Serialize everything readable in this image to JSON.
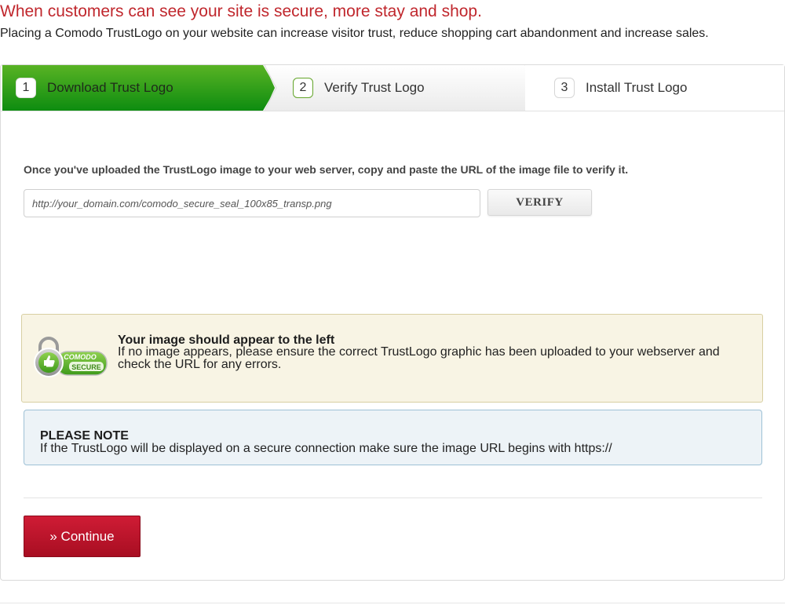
{
  "header": {
    "headline": "When customers can see your site is secure, more stay and shop.",
    "subline": "Placing a Comodo TrustLogo on your website can increase visitor trust, reduce shopping cart abandonment and increase sales."
  },
  "steps": [
    {
      "number": "1",
      "label": "Download Trust Logo",
      "state": "complete"
    },
    {
      "number": "2",
      "label": "Verify Trust Logo",
      "state": "current"
    },
    {
      "number": "3",
      "label": "Install Trust Logo",
      "state": "upcoming"
    }
  ],
  "verify": {
    "instruction": "Once you've uploaded the TrustLogo image to your web server, copy and paste the URL of the image file to verify it.",
    "url_placeholder": "http://your_domain.com/comodo_secure_seal_100x85_transp.png",
    "url_value": "",
    "button_label": "VERIFY"
  },
  "image_preview": {
    "title": "Your image should appear to the left",
    "text": "If no image appears, please ensure the correct TrustLogo graphic has been uploaded to your webserver and check the URL for any errors.",
    "seal_text_top": "COMODO",
    "seal_text_bottom": "SECURE"
  },
  "note": {
    "title": "PLEASE NOTE",
    "text": "If the TrustLogo will be displayed on a secure connection make sure the image URL begins with https://"
  },
  "continue_label": "» Continue",
  "colors": {
    "brand_red": "#c0272d",
    "step_green": "#0d8c10",
    "button_red": "#b8132a"
  }
}
